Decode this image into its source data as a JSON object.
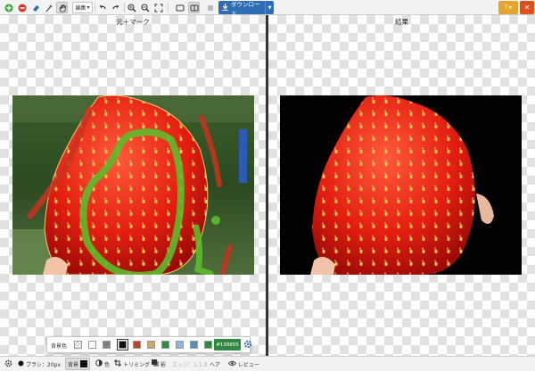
{
  "toolbar": {
    "edit_label": "編集",
    "download_label": "ダウンロード",
    "t_label": "T",
    "close_label": "✕",
    "icons": [
      "plus-icon",
      "minus-icon",
      "eraser-icon",
      "wand-icon",
      "hand-icon",
      "undo-icon",
      "redo-icon",
      "zoom-in-icon",
      "zoom-out-icon",
      "fit-icon",
      "single-view-icon",
      "split-view-icon",
      "crop-icon",
      "download-icon",
      "close-icon"
    ]
  },
  "panels": {
    "left_title": "元＋マーク",
    "right_title": "結果"
  },
  "palette": {
    "label": "背景色",
    "colors": [
      "transparent",
      "#ffffff",
      "#808080",
      "#111111",
      "#b5472e",
      "#c8a86b",
      "#2f8a3f",
      "#8fb5d9",
      "#5b8db8",
      "#2f8a3f"
    ],
    "arrow": "‹",
    "hex_value": "#138855"
  },
  "bottombar": {
    "brush_label": "ブラシ：20px",
    "background_label": "背景",
    "color_label": "色",
    "trim_label": "トリミング",
    "shadow_label": "影",
    "edge_label": "エッジ：1.1.0",
    "hair_label": "ヘア",
    "review_label": "レビュー"
  },
  "colors": {
    "accent_blue": "#2e6db4",
    "accent_orange": "#e3a62f",
    "accent_red": "#dd4f1c",
    "foreground_mark": "#5dbb2a",
    "background_mark": "#c8321f"
  }
}
